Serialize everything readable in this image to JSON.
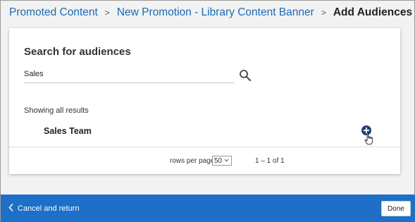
{
  "breadcrumb": {
    "items": [
      "Promoted Content",
      "New Promotion - Library Content Banner"
    ],
    "separator": ">",
    "current": "Add Audiences"
  },
  "search": {
    "title": "Search for audiences",
    "value": "Sales",
    "icon": "search-icon"
  },
  "results": {
    "status": "Showing all results",
    "items": [
      {
        "name": "Sales Team",
        "action_icon": "add-circle-icon"
      }
    ]
  },
  "pagination": {
    "rows_per_page_label": "rows per page",
    "rows_per_page_value": "50",
    "range": "1 – 1 of 1"
  },
  "footer": {
    "cancel_label": "Cancel and return",
    "done_label": "Done"
  },
  "colors": {
    "link": "#1a6bb8",
    "footer_bg": "#1d6fc8",
    "add_button": "#1d3f78"
  }
}
